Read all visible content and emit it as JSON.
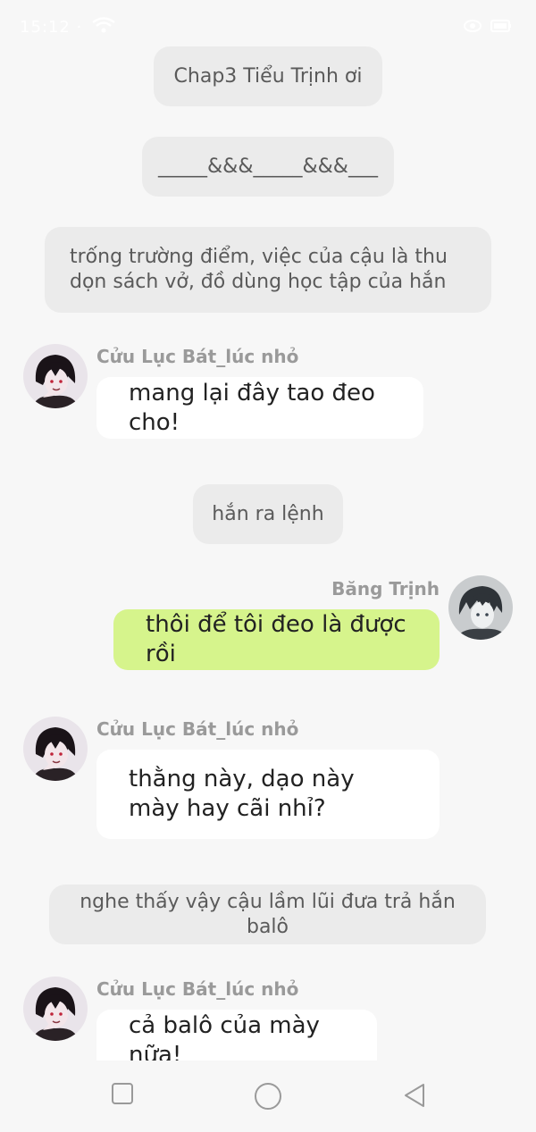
{
  "status_bar": {
    "time": "15:12",
    "separator": "·"
  },
  "colors": {
    "background": "#f7f7f7",
    "narration_bg": "#ebebeb",
    "other_bubble": "#ffffff",
    "my_bubble": "#d6f48c",
    "sender_name": "#9a9a9a"
  },
  "messages": [
    {
      "kind": "narration",
      "text": "Chap3 Tiểu Trịnh ơi"
    },
    {
      "kind": "narration",
      "text": "_____&&&_____&&&___"
    },
    {
      "kind": "narration",
      "text": "trống trường điểm, việc của cậu là thu dọn sách vở, đồ dùng học tập của hắn"
    },
    {
      "kind": "incoming",
      "sender": "Cửu Lục Bát_lúc nhỏ",
      "text": "mang lại đây tao đeo cho!"
    },
    {
      "kind": "narration",
      "text": "hắn ra lệnh"
    },
    {
      "kind": "outgoing",
      "sender": "Băng Trịnh",
      "text": "thôi để tôi đeo là được rồi"
    },
    {
      "kind": "incoming",
      "sender": "Cửu Lục Bát_lúc nhỏ",
      "text": "thằng này, dạo này mày hay cãi nhỉ?"
    },
    {
      "kind": "narration",
      "text": "nghe thấy vậy cậu lầm lũi đưa trả hắn balô"
    },
    {
      "kind": "incoming",
      "sender": "Cửu Lục Bát_lúc nhỏ",
      "text": "cả balô của mày nữa!"
    }
  ],
  "nav": {
    "recents": "square-icon",
    "home": "circle-icon",
    "back": "triangle-back-icon"
  }
}
